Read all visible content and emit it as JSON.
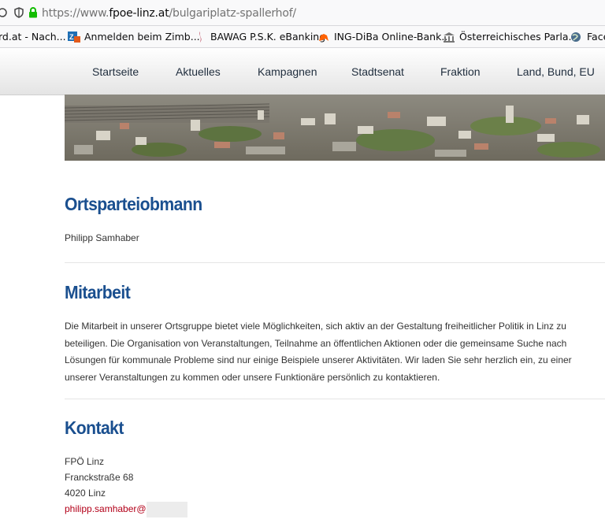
{
  "browser": {
    "url_prefix": "https://www.",
    "url_host": "fpoe-linz.at",
    "url_path": "/bulgariplatz-spallerhof/"
  },
  "bookmarks": [
    {
      "label": "rd.at - Nach...",
      "icon": "partial-site-icon"
    },
    {
      "label": "Anmelden beim Zimb...",
      "icon": "zimbra-icon"
    },
    {
      "label": "BAWAG P.S.K. eBanking",
      "icon": "bawag-icon"
    },
    {
      "label": "ING-DiBa Online-Bank...",
      "icon": "ing-lion-icon"
    },
    {
      "label": "Österreichisches Parla...",
      "icon": "parliament-icon"
    },
    {
      "label": "Face",
      "icon": "globe-icon"
    }
  ],
  "nav": [
    {
      "label": "Startseite"
    },
    {
      "label": "Aktuelles"
    },
    {
      "label": "Kampagnen"
    },
    {
      "label": "Stadtsenat"
    },
    {
      "label": "Fraktion"
    },
    {
      "label": "Land, Bund, EU"
    }
  ],
  "sections": {
    "chairman": {
      "heading": "Ortsparteiobmann",
      "name": "Philipp Samhaber"
    },
    "participation": {
      "heading": "Mitarbeit",
      "lines": [
        "Die Mitarbeit in unserer Ortsgruppe bietet viele Möglichkeiten, sich aktiv an der Gestaltung freiheitlicher Politik in Linz zu",
        "beteiligen. Die Organisation von Veranstaltungen, Teilnahme an öffentlichen Aktionen oder die gemeinsame Suche nach",
        "Lösungen für kommunale Probleme sind nur einige Beispiele unserer Aktivitäten. Wir laden Sie sehr herzlich ein, zu einer",
        "unserer Veranstaltungen zu kommen oder unsere Funktionäre persönlich zu kontaktieren."
      ]
    },
    "contact": {
      "heading": "Kontakt",
      "org": "FPÖ Linz",
      "street": "Franckstraße 68",
      "city": "4020 Linz",
      "email": "philipp.samhaber@"
    }
  },
  "colors": {
    "heading": "#1a4f8f",
    "email": "#b30019",
    "nav_text": "#1f2d3d"
  }
}
